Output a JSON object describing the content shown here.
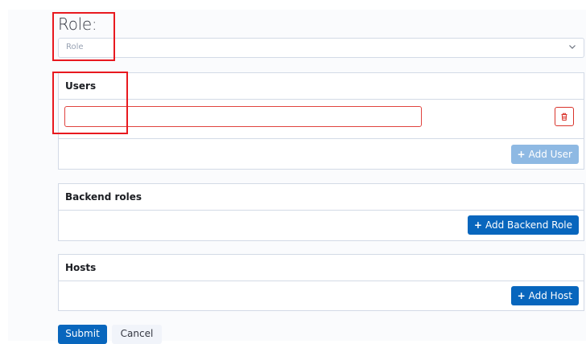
{
  "role": {
    "title": "Role:",
    "placeholder": "Role"
  },
  "users": {
    "heading": "Users",
    "input_value": "",
    "add_label": "Add User"
  },
  "backend_roles": {
    "heading": "Backend roles",
    "add_label": "Add Backend Role"
  },
  "hosts": {
    "heading": "Hosts",
    "add_label": "Add Host"
  },
  "actions": {
    "submit_label": "Submit",
    "cancel_label": "Cancel"
  },
  "icons": {
    "plus": "+",
    "chevron": "﹀"
  },
  "colors": {
    "primary": "#0866bd",
    "primary_disabled": "#8eb9e3",
    "danger": "#e0433f",
    "highlight": "#e8191f",
    "border": "#d3dae6"
  }
}
